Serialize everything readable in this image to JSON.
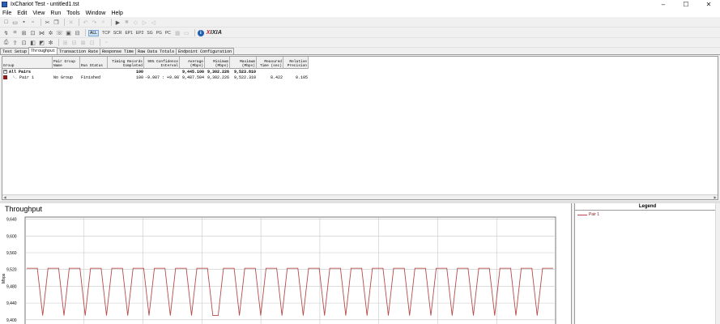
{
  "window": {
    "title": "IxChariot Test - untitled1.tst",
    "min": "–",
    "max": "☐",
    "close": "✕"
  },
  "menu": [
    "File",
    "Edit",
    "View",
    "Run",
    "Tools",
    "Window",
    "Help"
  ],
  "toolbar2": {
    "protocols": [
      "ALL",
      "TCP",
      "SCR",
      "EP1",
      "EP2",
      "SG",
      "PG",
      "PC"
    ],
    "brand_prefix": "X",
    "brand": "IXIA"
  },
  "tabs": [
    "Test Setup",
    "Throughput",
    "Transaction Rate",
    "Response Time",
    "Raw Data Totals",
    "Endpoint Configuration"
  ],
  "active_tab": "Throughput",
  "grid": {
    "columns": [
      "Group",
      "Pair Group Name",
      "Run Status",
      "Timing Records Completed",
      "95% Confidence Interval",
      "Average (Mbps)",
      "Minimum (Mbps)",
      "Maximum (Mbps)",
      "Measured Time (sec)",
      "Relative Precision"
    ],
    "all_pairs": {
      "group": "All Pairs",
      "timing": "100",
      "average": "9,445.100",
      "minimum": "9,302.226",
      "maximum": "9,523.810"
    },
    "pair1": {
      "group": "Pair 1",
      "pair_group": "No Group",
      "status": "Finished",
      "timing": "100",
      "ci": "-9.987 : +9.987",
      "average": "9,487.504",
      "minimum": "9,302.226",
      "maximum": "9,522.310",
      "time": "8.422",
      "precision": "0.105"
    }
  },
  "chart": {
    "title": "Throughput",
    "ylabel": "Mbps"
  },
  "legend": {
    "title": "Legend",
    "items": [
      "Pair 1"
    ]
  },
  "chart_data": {
    "type": "line",
    "title": "Throughput",
    "ylabel": "Mbps",
    "yticks": [
      "9,640",
      "9,600",
      "9,560",
      "9,520",
      "9,480",
      "9,440",
      "9,400"
    ],
    "ylim": [
      9390,
      9645
    ],
    "series": [
      {
        "name": "Pair 1",
        "color": "#b84a4a",
        "values": [
          9523,
          9523,
          9523,
          9410,
          9523,
          9523,
          9523,
          9410,
          9523,
          9523,
          9523,
          9410,
          9523,
          9523,
          9523,
          9410,
          9523,
          9523,
          9523,
          9410,
          9523,
          9523,
          9523,
          9410,
          9523,
          9523,
          9523,
          9410,
          9523,
          9523,
          9523,
          9410,
          9523,
          9523,
          9523,
          9410,
          9410,
          9523,
          9523,
          9523,
          9410,
          9523,
          9523,
          9523,
          9410,
          9523,
          9523,
          9523,
          9410,
          9523,
          9523,
          9523,
          9410,
          9523,
          9523,
          9523,
          9410,
          9523,
          9523,
          9523,
          9410,
          9523,
          9523,
          9523,
          9410,
          9523,
          9523,
          9523,
          9410,
          9523,
          9523,
          9523,
          9410,
          9523,
          9523,
          9523,
          9410,
          9523,
          9523,
          9523,
          9410,
          9523,
          9523,
          9523,
          9410,
          9523,
          9523,
          9523,
          9410,
          9523,
          9523,
          9523,
          9410,
          9523,
          9523,
          9523,
          9410,
          9523,
          9523,
          9523
        ]
      }
    ]
  }
}
